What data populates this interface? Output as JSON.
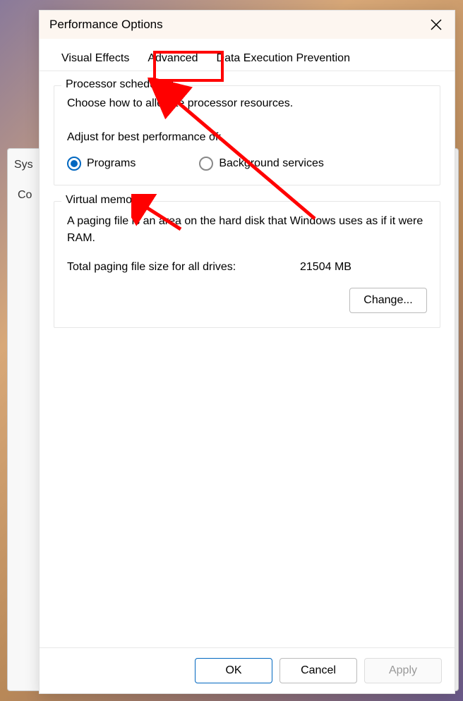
{
  "background": {
    "partial_tab": "Sys",
    "partial_row": "Co"
  },
  "dialog": {
    "title": "Performance Options",
    "tabs": {
      "visual": "Visual Effects",
      "advanced": "Advanced",
      "dep": "Data Execution Prevention"
    },
    "processor": {
      "legend": "Processor scheduling",
      "desc": "Choose how to allocate processor resources.",
      "adjust_label": "Adjust for best performance of:",
      "programs": "Programs",
      "background": "Background services"
    },
    "vm": {
      "legend": "Virtual memory",
      "desc": "A paging file is an area on the hard disk that Windows uses as if it were RAM.",
      "total_label": "Total paging file size for all drives:",
      "total_value": "21504 MB",
      "change": "Change..."
    },
    "footer": {
      "ok": "OK",
      "cancel": "Cancel",
      "apply": "Apply"
    }
  }
}
